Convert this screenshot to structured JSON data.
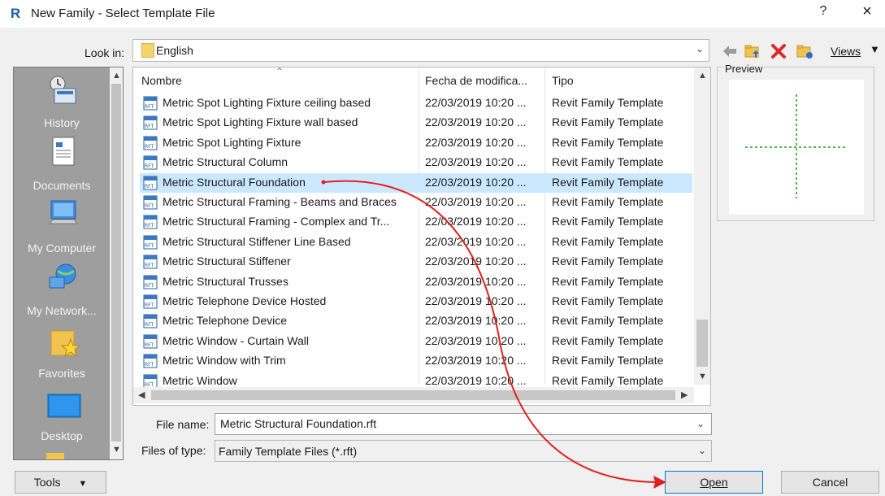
{
  "window": {
    "title": "New Family - Select Template File",
    "app_icon_letter": "R",
    "help_label": "?",
    "close_label": "×"
  },
  "lookin": {
    "label": "Look in:",
    "value": "English"
  },
  "toolbar": {
    "views_label": "Views",
    "icons": [
      "back-arrow-icon",
      "up-folder-icon",
      "delete-icon",
      "new-folder-icon",
      "views-icon"
    ]
  },
  "places": [
    {
      "label": "History",
      "icon": "history-icon"
    },
    {
      "label": "Documents",
      "icon": "documents-icon"
    },
    {
      "label": "My Computer",
      "icon": "computer-icon"
    },
    {
      "label": "My Network...",
      "icon": "network-icon"
    },
    {
      "label": "Favorites",
      "icon": "favorites-icon"
    },
    {
      "label": "Desktop",
      "icon": "desktop-icon"
    }
  ],
  "columns": {
    "name": "Nombre",
    "date": "Fecha de modifica...",
    "type": "Tipo"
  },
  "files": [
    {
      "name": "Metric Spot Lighting Fixture ceiling based",
      "date": "22/03/2019 10:20 ...",
      "type": "Revit Family Template"
    },
    {
      "name": "Metric Spot Lighting Fixture wall based",
      "date": "22/03/2019 10:20 ...",
      "type": "Revit Family Template"
    },
    {
      "name": "Metric Spot Lighting Fixture",
      "date": "22/03/2019 10:20 ...",
      "type": "Revit Family Template"
    },
    {
      "name": "Metric Structural Column",
      "date": "22/03/2019 10:20 ...",
      "type": "Revit Family Template"
    },
    {
      "name": "Metric Structural Foundation",
      "date": "22/03/2019 10:20 ...",
      "type": "Revit Family Template"
    },
    {
      "name": "Metric Structural Framing - Beams and Braces",
      "date": "22/03/2019 10:20 ...",
      "type": "Revit Family Template"
    },
    {
      "name": "Metric Structural Framing - Complex and Tr...",
      "date": "22/03/2019 10:20 ...",
      "type": "Revit Family Template"
    },
    {
      "name": "Metric Structural Stiffener Line Based",
      "date": "22/03/2019 10:20 ...",
      "type": "Revit Family Template"
    },
    {
      "name": "Metric Structural Stiffener",
      "date": "22/03/2019 10:20 ...",
      "type": "Revit Family Template"
    },
    {
      "name": "Metric Structural Trusses",
      "date": "22/03/2019 10:20 ...",
      "type": "Revit Family Template"
    },
    {
      "name": "Metric Telephone Device Hosted",
      "date": "22/03/2019 10:20 ...",
      "type": "Revit Family Template"
    },
    {
      "name": "Metric Telephone Device",
      "date": "22/03/2019 10:20 ...",
      "type": "Revit Family Template"
    },
    {
      "name": "Metric Window - Curtain Wall",
      "date": "22/03/2019 10:20 ...",
      "type": "Revit Family Template"
    },
    {
      "name": "Metric Window with Trim",
      "date": "22/03/2019 10:20 ...",
      "type": "Revit Family Template"
    },
    {
      "name": "Metric Window",
      "date": "22/03/2019 10:20 ...",
      "type": "Revit Family Template"
    }
  ],
  "file_icon_label": "RFT",
  "selected_index": 4,
  "preview": {
    "label": "Preview"
  },
  "fields": {
    "filename_label": "File name:",
    "filename_value": "Metric Structural Foundation.rft",
    "filetype_label": "Files of type:",
    "filetype_value": "Family Template Files  (*.rft)"
  },
  "buttons": {
    "tools": "Tools",
    "open": "Open",
    "cancel": "Cancel"
  },
  "colors": {
    "selection": "#cce8ff",
    "annotation_arrow": "#e02020",
    "preview_crosshair": "#1a9a1a"
  }
}
